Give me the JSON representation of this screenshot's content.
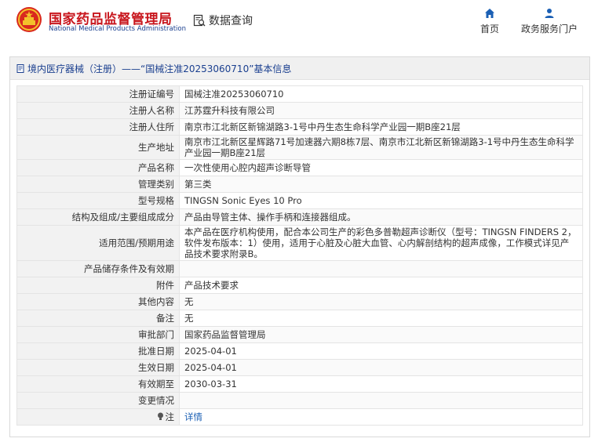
{
  "header": {
    "site_name_cn": "国家药品监督管理局",
    "site_name_en": "National Medical Products Administration",
    "query_label": "数据查询",
    "nav": [
      {
        "label": "首页",
        "icon": "home-icon"
      },
      {
        "label": "政务服务门户",
        "icon": "user-icon"
      }
    ],
    "colors": {
      "brand_red": "#c8161d",
      "brand_blue": "#1a3f8f",
      "nav_blue": "#1a5fb4"
    }
  },
  "panel": {
    "title": "境内医疗器械（注册）——“国械注准20253060710”基本信息"
  },
  "rows": [
    {
      "label": "注册证编号",
      "value": "国械注准20253060710"
    },
    {
      "label": "注册人名称",
      "value": "江苏霆升科技有限公司"
    },
    {
      "label": "注册人住所",
      "value": "南京市江北新区新锦湖路3-1号中丹生态生命科学产业园一期B座21层"
    },
    {
      "label": "生产地址",
      "value": "南京市江北新区星辉路71号加速器六期8栋7层、南京市江北新区新锦湖路3-1号中丹生态生命科学产业园一期B座21层"
    },
    {
      "label": "产品名称",
      "value": "一次性使用心腔内超声诊断导管"
    },
    {
      "label": "管理类别",
      "value": "第三类"
    },
    {
      "label": "型号规格",
      "value": "TINGSN Sonic Eyes 10 Pro"
    },
    {
      "label": "结构及组成/主要组成成分",
      "value": "产品由导管主体、操作手柄和连接器组成。"
    },
    {
      "label": "适用范围/预期用途",
      "value": "本产品在医疗机构使用，配合本公司生产的彩色多普勒超声诊断仪（型号：TINGSN FINDERS 2，软件发布版本：1）使用，适用于心脏及心脏大血管、心内解剖结构的超声成像，工作模式详见产品技术要求附录B。"
    },
    {
      "label": "产品储存条件及有效期",
      "value": ""
    },
    {
      "label": "附件",
      "value": "产品技术要求"
    },
    {
      "label": "其他内容",
      "value": "无"
    },
    {
      "label": "备注",
      "value": "无"
    },
    {
      "label": "审批部门",
      "value": "国家药品监督管理局"
    },
    {
      "label": "批准日期",
      "value": "2025-04-01"
    },
    {
      "label": "生效日期",
      "value": "2025-04-01"
    },
    {
      "label": "有效期至",
      "value": "2030-03-31"
    },
    {
      "label": "变更情况",
      "value": ""
    },
    {
      "label": "注",
      "value": "详情",
      "icon": "bulb-icon"
    }
  ]
}
